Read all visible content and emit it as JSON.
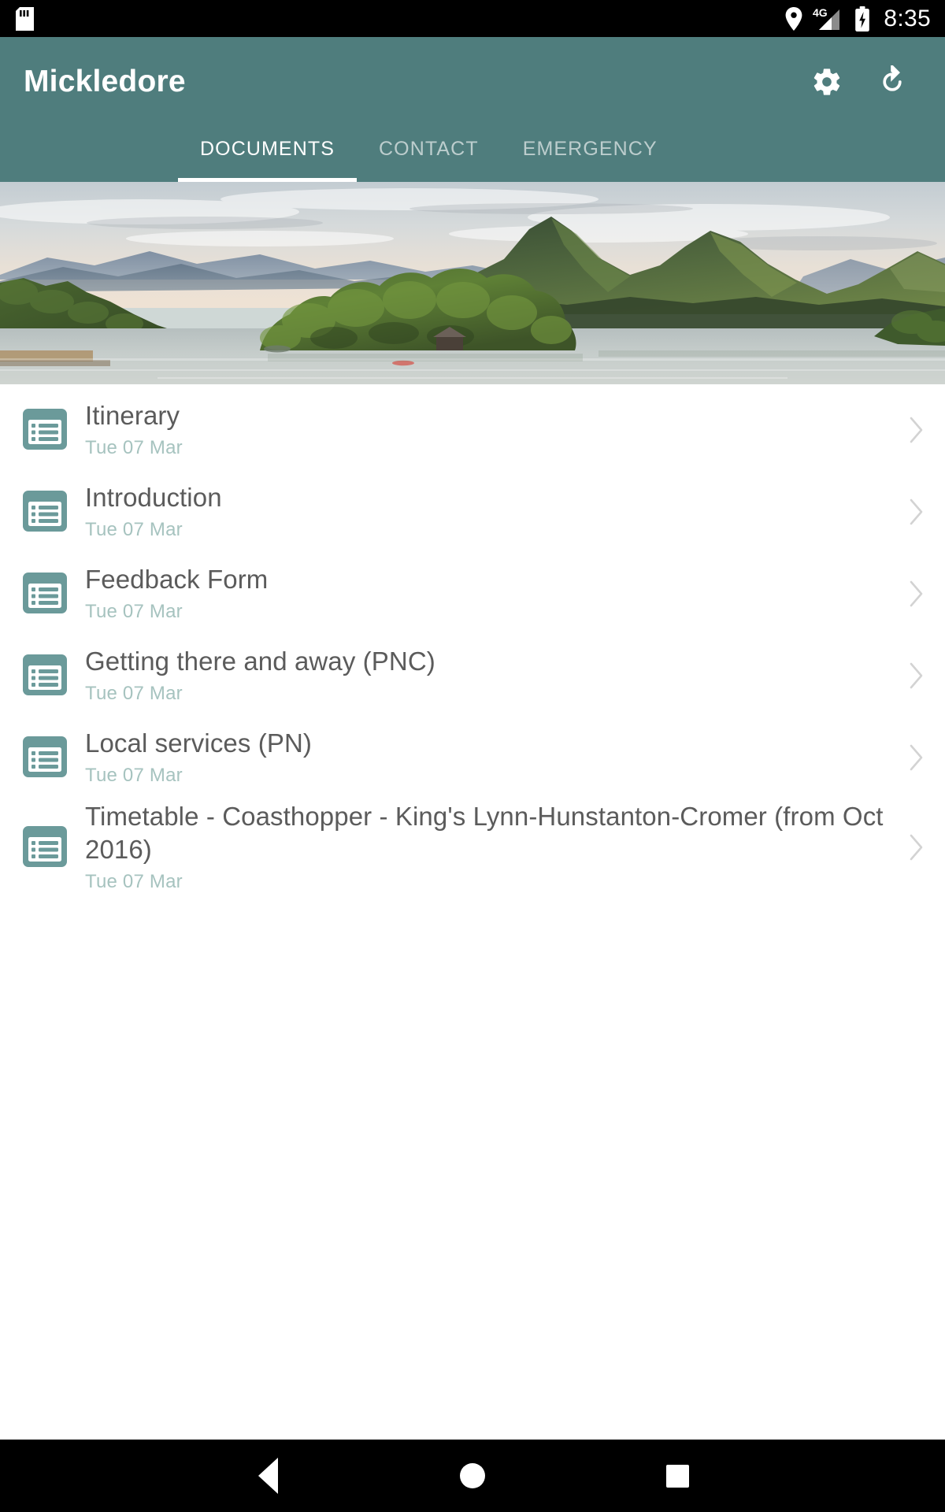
{
  "statusbar": {
    "time": "8:35",
    "icons": [
      "sd-card-icon",
      "location-pin-icon",
      "network-4g-icon",
      "battery-charging-icon"
    ],
    "network_label": "4G"
  },
  "appbar": {
    "title": "Mickledore",
    "actions": [
      {
        "name": "settings-gear-button",
        "icon": "gear-icon"
      },
      {
        "name": "refresh-button",
        "icon": "refresh-icon"
      }
    ],
    "background_color": "#4f7d7d"
  },
  "tabs": [
    {
      "label": "DOCUMENTS",
      "active": true
    },
    {
      "label": "CONTACT",
      "active": false
    },
    {
      "label": "EMERGENCY",
      "active": false
    }
  ],
  "hero": {
    "alt": "Lake with forested island and green mountains at dusk"
  },
  "documents": {
    "items": [
      {
        "title": "Itinerary",
        "date": "Tue 07 Mar"
      },
      {
        "title": "Introduction",
        "date": "Tue 07 Mar"
      },
      {
        "title": "Feedback Form",
        "date": "Tue 07 Mar"
      },
      {
        "title": "Getting there and away (PNC)",
        "date": "Tue 07 Mar"
      },
      {
        "title": "Local services (PN)",
        "date": "Tue 07 Mar"
      },
      {
        "title": "Timetable - Coasthopper - King's Lynn-Hunstanton-Cromer (from Oct 2016)",
        "date": "Tue 07 Mar"
      }
    ],
    "icon": "document-list-icon",
    "chevron": "chevron-right-icon",
    "icon_color": "#6b9a9a",
    "title_color": "#5b5b5b",
    "date_color": "#a6c3bf"
  },
  "navbar": {
    "buttons": [
      {
        "name": "nav-back-button",
        "icon": "triangle-back-icon"
      },
      {
        "name": "nav-home-button",
        "icon": "circle-home-icon"
      },
      {
        "name": "nav-recents-button",
        "icon": "square-recents-icon"
      }
    ]
  }
}
